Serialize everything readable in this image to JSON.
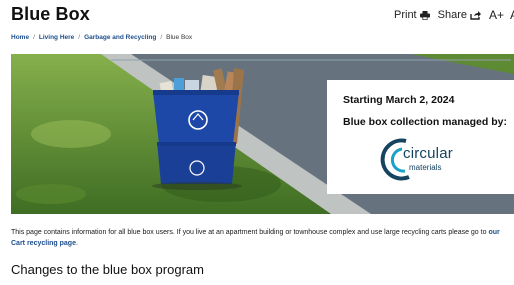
{
  "page": {
    "title": "Blue Box"
  },
  "tools": {
    "print": "Print",
    "share": "Share",
    "text_larger": "A+",
    "text_alt": "A"
  },
  "breadcrumb": {
    "items": [
      "Home",
      "Living Here",
      "Garbage and Recycling"
    ],
    "current": "Blue Box",
    "separator": "/"
  },
  "hero": {
    "line1": "Starting March 2, 2024",
    "line2": "Blue box collection managed by:",
    "logo_word1": "circular",
    "logo_word2": "materials"
  },
  "intro": {
    "text_before": "This page contains information for all blue box users. If you live at an apartment building or townhouse complex and use large recycling carts please go to ",
    "link": "our Cart recycling page",
    "text_after": "."
  },
  "section": {
    "heading": "Changes to the blue box program"
  },
  "colors": {
    "link": "#1d4e8f",
    "bin_blue": "#1e48a8",
    "logo_blue": "#16435f",
    "logo_teal": "#1aa1c9"
  }
}
